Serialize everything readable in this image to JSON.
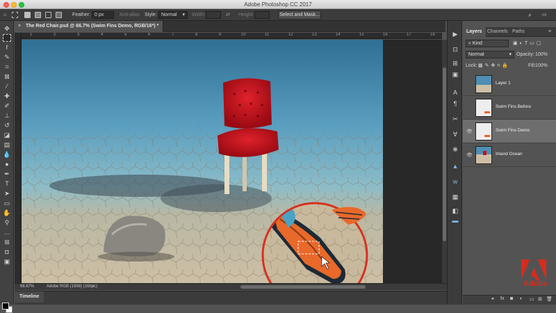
{
  "app_title": "Adobe Photoshop CC 2017",
  "options_bar": {
    "feather_label": "Feather:",
    "feather_value": "0 px",
    "antialias_label": "Anti-alias",
    "style_label": "Style:",
    "style_value": "Normal",
    "width_label": "Width:",
    "height_label": "Height:",
    "select_mask_label": "Select and Mask..."
  },
  "document": {
    "tab_title": "The Red Chair.psd @ 66.7% (Swim Fins Demo, RGB/16*) *",
    "close_glyph": "×",
    "ruler_ticks": [
      "1",
      "2",
      "3",
      "4",
      "5",
      "6",
      "7",
      "8",
      "9",
      "10",
      "11",
      "12",
      "13",
      "14",
      "15",
      "16",
      "17",
      "18"
    ],
    "zoom": "66.67%",
    "profile": "Adobe RGB (1998) (16bpc)"
  },
  "timeline": {
    "label": "Timeline"
  },
  "panels": {
    "tabs": [
      "Layers",
      "Channels",
      "Paths"
    ],
    "active_tab": "Layers",
    "filter_value": "Kind",
    "blend_mode": "Normal",
    "opacity_label": "Opacity:",
    "opacity_value": "100%",
    "lock_label": "Lock:",
    "fill_label": "Fill:",
    "fill_value": "100%",
    "layers": [
      {
        "name": "Layer 1",
        "visible": false,
        "selected": false
      },
      {
        "name": "Swim Fins Before",
        "visible": false,
        "selected": false
      },
      {
        "name": "Swim Fins Demo",
        "visible": true,
        "selected": true
      },
      {
        "name": "Inland Ocean",
        "visible": true,
        "selected": false
      }
    ],
    "bottom_icons": [
      "link-icon",
      "fx-icon",
      "mask-icon",
      "adjustment-icon",
      "folder-icon",
      "new-layer-icon",
      "trash-icon"
    ]
  },
  "branding": {
    "adobe_word": "Adobe"
  },
  "colors": {
    "chair_red": "#c8101a",
    "fin_orange": "#e8692a",
    "sea_blue": "#5a9ec0",
    "sand": "#cdbfa5",
    "highlight_ring": "#d7311f"
  }
}
